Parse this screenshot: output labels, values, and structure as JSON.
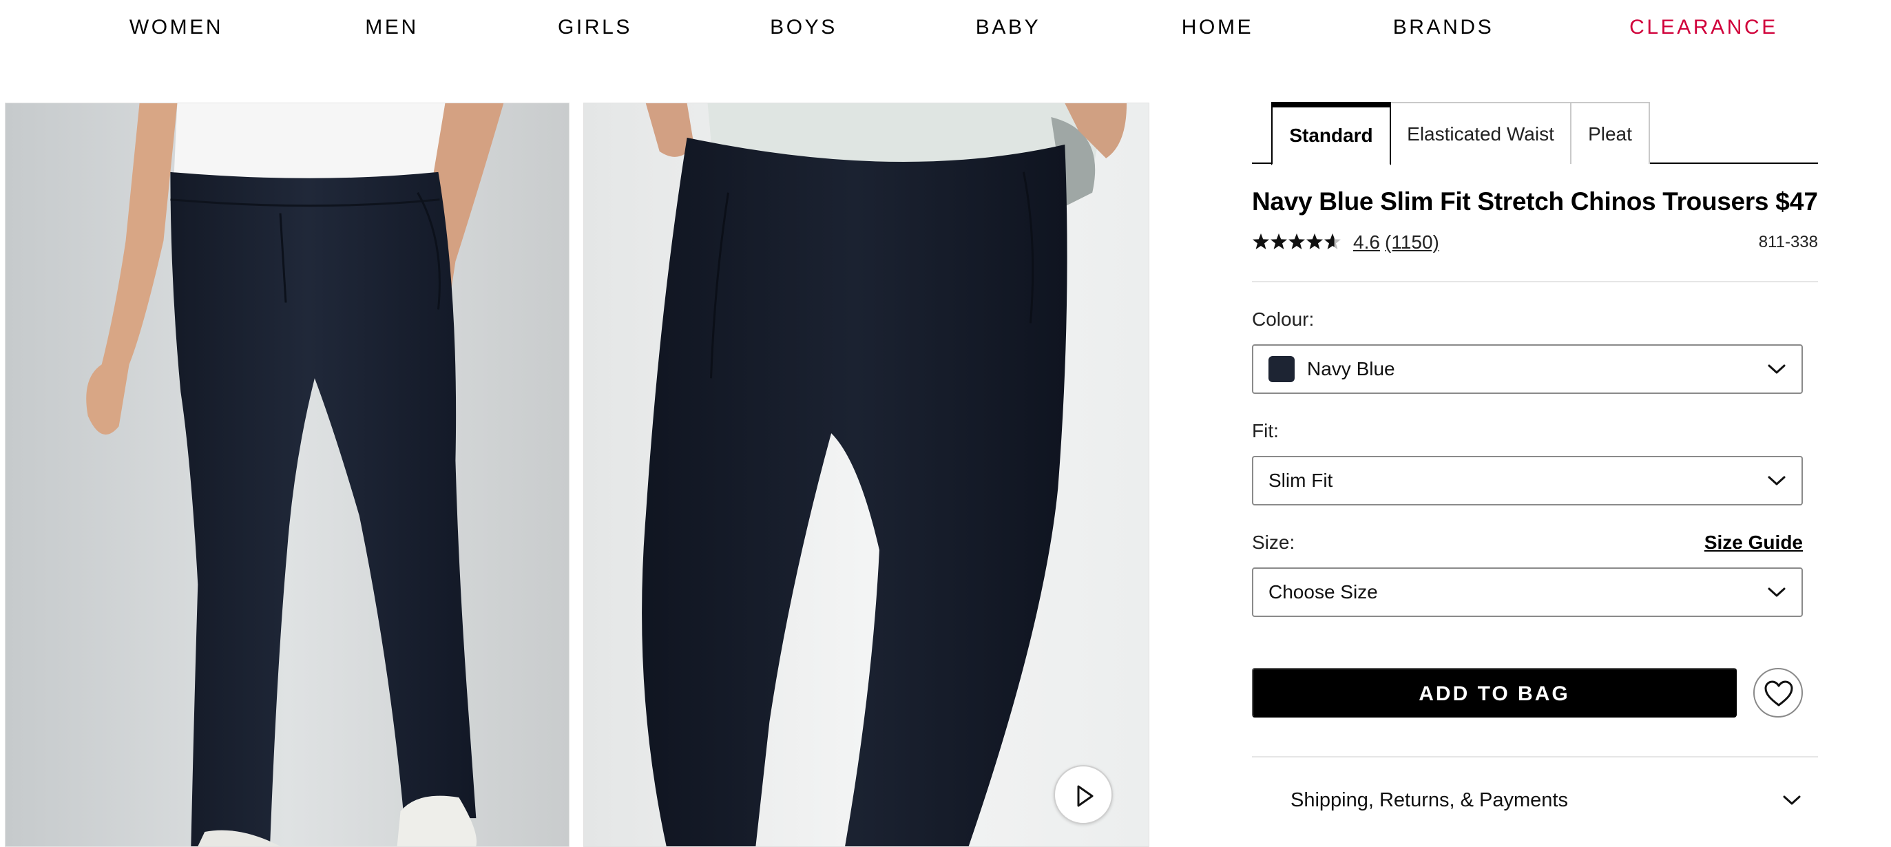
{
  "nav": {
    "items": [
      {
        "label": "WOMEN"
      },
      {
        "label": "MEN"
      },
      {
        "label": "GIRLS"
      },
      {
        "label": "BOYS"
      },
      {
        "label": "BABY"
      },
      {
        "label": "HOME"
      },
      {
        "label": "BRANDS"
      },
      {
        "label": "CLEARANCE"
      }
    ],
    "highlight_color": "#d0003a"
  },
  "gallery": {
    "images": [
      {
        "alt_icon": "product-photo-front"
      },
      {
        "alt_icon": "product-photo-closeup"
      }
    ],
    "video_button_icon": "play-icon"
  },
  "product": {
    "fit_tabs": [
      {
        "label": "Standard",
        "active": true
      },
      {
        "label": "Elasticated Waist",
        "active": false
      },
      {
        "label": "Pleat",
        "active": false
      }
    ],
    "title": "Navy Blue Slim Fit Stretch Chinos Trousers",
    "price": "$47",
    "rating": {
      "value": "4.6",
      "reviews": "(1150)",
      "stars_out_of_5": 4.6
    },
    "item_code": "811-338",
    "colour": {
      "label": "Colour:",
      "value": "Navy Blue",
      "swatch": "#1d2433"
    },
    "fit": {
      "label": "Fit:",
      "value": "Slim Fit"
    },
    "size": {
      "label": "Size:",
      "value": "Choose Size",
      "guide_label": "Size Guide"
    },
    "add_to_bag": "ADD TO BAG",
    "wishlist_icon": "heart-icon",
    "shipping": {
      "label": "Shipping, Returns, & Payments"
    }
  }
}
